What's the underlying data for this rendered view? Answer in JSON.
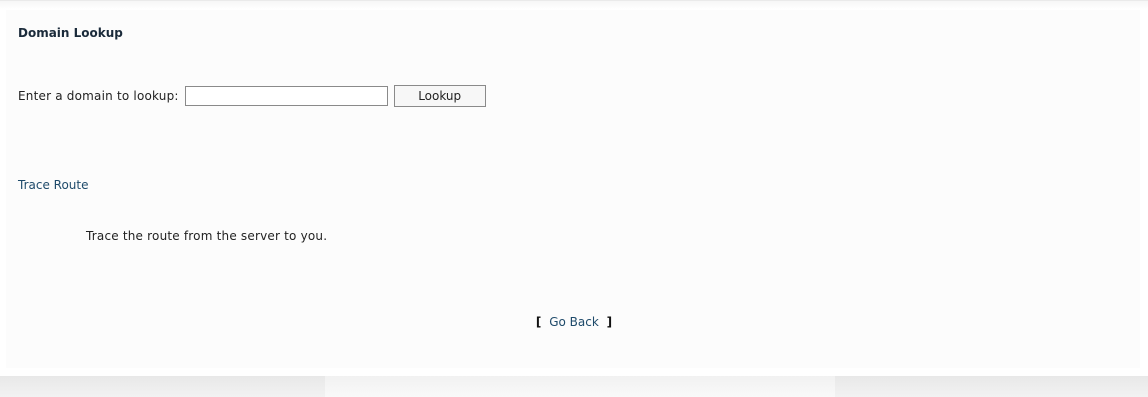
{
  "domain_lookup": {
    "title": "Domain Lookup",
    "label": "Enter a domain to lookup:",
    "input_value": "",
    "input_placeholder": "",
    "button_label": "Lookup"
  },
  "trace_route": {
    "link_label": "Trace Route",
    "description": "Trace the route from the server to you."
  },
  "footer": {
    "open_bracket": "[",
    "go_back_label": "Go Back",
    "close_bracket": "]"
  }
}
